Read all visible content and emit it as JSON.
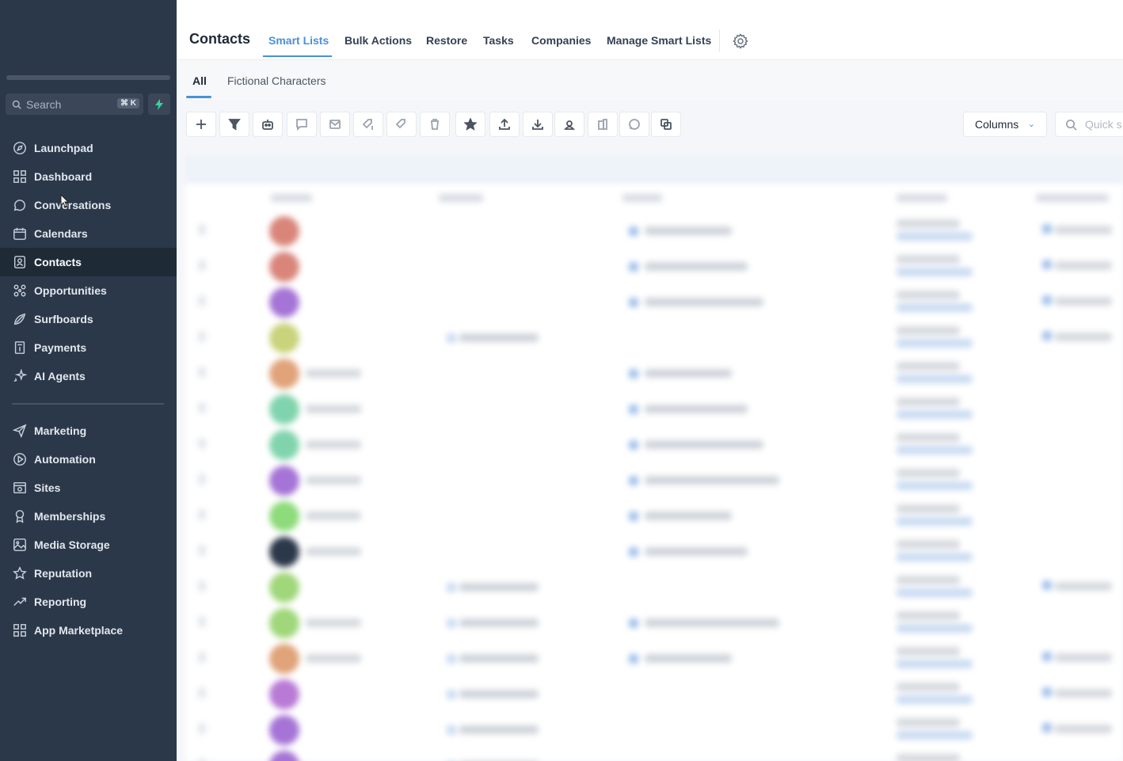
{
  "sidebar": {
    "search_placeholder": "Search",
    "search_shortcut": "⌘ K",
    "items": [
      {
        "label": "Launchpad",
        "icon": "launchpad-icon"
      },
      {
        "label": "Dashboard",
        "icon": "dashboard-icon"
      },
      {
        "label": "Conversations",
        "icon": "conversations-icon"
      },
      {
        "label": "Calendars",
        "icon": "calendar-icon"
      },
      {
        "label": "Contacts",
        "icon": "contacts-icon",
        "active": true
      },
      {
        "label": "Opportunities",
        "icon": "opportunities-icon"
      },
      {
        "label": "Surfboards",
        "icon": "surfboards-icon"
      },
      {
        "label": "Payments",
        "icon": "payments-icon"
      },
      {
        "label": "AI Agents",
        "icon": "ai-agents-icon"
      }
    ],
    "items2": [
      {
        "label": "Marketing",
        "icon": "marketing-icon"
      },
      {
        "label": "Automation",
        "icon": "automation-icon"
      },
      {
        "label": "Sites",
        "icon": "sites-icon"
      },
      {
        "label": "Memberships",
        "icon": "memberships-icon"
      },
      {
        "label": "Media Storage",
        "icon": "media-storage-icon"
      },
      {
        "label": "Reputation",
        "icon": "reputation-icon"
      },
      {
        "label": "Reporting",
        "icon": "reporting-icon"
      },
      {
        "label": "App Marketplace",
        "icon": "app-marketplace-icon"
      }
    ]
  },
  "header": {
    "title": "Contacts",
    "tabs": [
      "Smart Lists",
      "Bulk Actions",
      "Restore",
      "Tasks",
      "Companies",
      "Manage Smart Lists"
    ],
    "active_tab": "Smart Lists"
  },
  "subtabs": [
    "All",
    "Fictional Characters"
  ],
  "toolbar": {
    "columns_label": "Columns",
    "quick_search_placeholder": "Quick s"
  },
  "colors": {
    "sidebar_bg": "#2b3849",
    "accent": "#4a90d9"
  },
  "avatar_colors": [
    "#d9857a",
    "#d9857a",
    "#a574d6",
    "#c9d37a",
    "#e0a37a",
    "#80d4ad",
    "#80d4ad",
    "#a574d6",
    "#8ddb7a",
    "#2b3849",
    "#9fd77a",
    "#9fd77a",
    "#e0a37a",
    "#b97ad6",
    "#a574d6",
    "#a574d6"
  ]
}
